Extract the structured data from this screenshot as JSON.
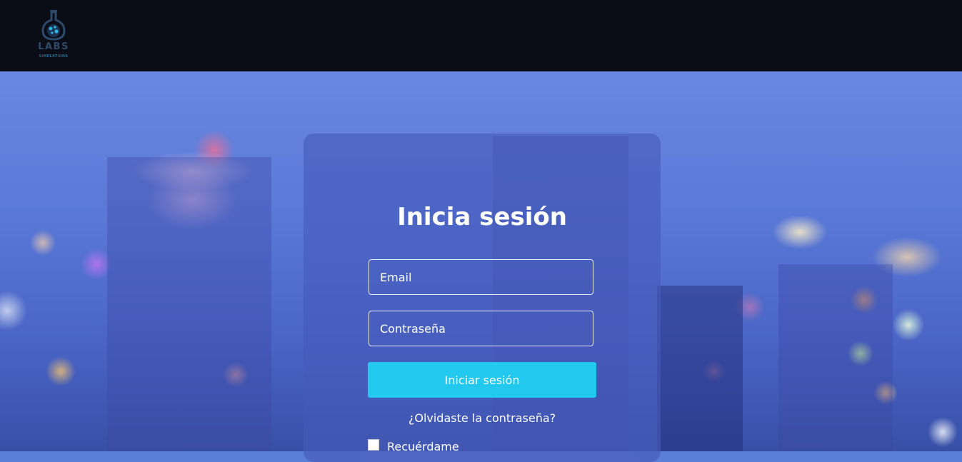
{
  "header": {
    "logo": {
      "text": "LABS",
      "subtext": "SIMULATIONS",
      "icon": "flask-icon"
    }
  },
  "login": {
    "title": "Inicia sesión",
    "email_placeholder": "Email",
    "password_placeholder": "Contraseña",
    "submit_label": "Iniciar sesión",
    "forgot_label": "¿Olvidaste la contraseña?",
    "remember_label": "Recuérdame",
    "remember_checked": false
  },
  "colors": {
    "topbar": "#0a0d16",
    "accent_button": "#22c8ee",
    "card": "#465ab9"
  }
}
